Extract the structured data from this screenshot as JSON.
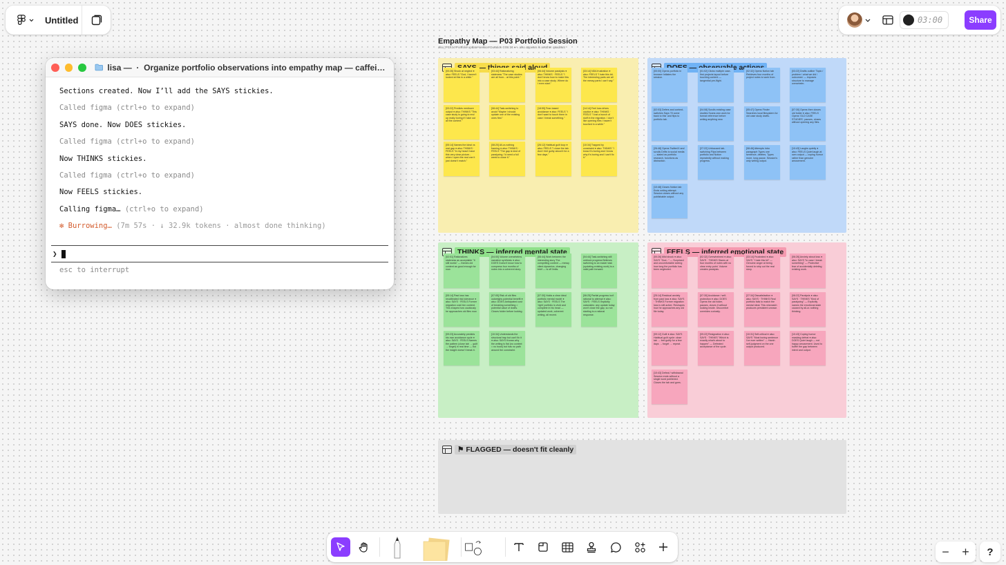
{
  "file": {
    "title": "Untitled"
  },
  "topbar": {
    "timer": "03:00",
    "share_label": "Share"
  },
  "terminal": {
    "folder": "lisa —",
    "title": "Organize portfolio observations into empathy map — caffeinate...",
    "lines": [
      {
        "text": "Sections created. Now I’ll add the SAYS stickies.",
        "style": "bold"
      },
      {
        "text": "Called figma (ctrl+o to expand)",
        "style": "dim"
      },
      {
        "text": "SAYS done. Now DOES stickies.",
        "style": "bold"
      },
      {
        "text": "Called figma (ctrl+o to expand)",
        "style": "dim"
      },
      {
        "text": "Now THINKS stickies.",
        "style": "bold"
      },
      {
        "text": "Called figma (ctrl+o to expand)",
        "style": "dim"
      },
      {
        "text": "Now FEELS stickies.",
        "style": "bold"
      },
      {
        "text": "Calling figma…",
        "style": "bold",
        "suffix": "(ctrl+o to expand)"
      }
    ],
    "status": {
      "star": "✻",
      "word": "Burrowing…",
      "meta": "(7m 57s · ↓ 32.9k tokens · almost done thinking)"
    },
    "prompt_symbol": "❯",
    "hint": "esc to interrupt"
  },
  "board": {
    "title": "Empathy Map — P03 Portfolio Session",
    "subtitle": "also_P03.txt     Portfolio update session     Duration 0:26:14     ● = also appears in another quadrant",
    "sections": [
      {
        "id": "says",
        "label": "SAYS — things said aloud",
        "color": "#f9eeb0",
        "tag_color": "#f7dc4a",
        "sticky_color": "#fde74c",
        "stickies": [
          "[00:26] Shock at neglect ● also: FEELS \"God, I haven't looked at this in a while.\"",
          "[03:44] Rationalizing staleness \"The case studies are all from... at this point.\"",
          "[06:44] Volume paralysis ● also: THINKS · FEELS \"I don't know how to make this into a case study. Where do I even start.\"",
          "[33:14] NDA frustration ● also: FEELS \"I hate this bit. The interesting parts are all the messy parts I can't say.\"",
          "[03:22] Predicts mediocre output ● also: THINKS \"This case study is going to end up really boring if I take out all the context.\"",
          "[08:44] Task-switching to avoid \"Maybe I should update one of the existing ones first.\"",
          "[18:55] Fear-based avoidance ● also: FEELS \"I don't want to touch them in case I break something.\"",
          "[14:14] Feel loss drives caution ● also: THINKS · FEELS \"I lost a bunch of stuff in the migration. I don't like opening files I haven't touched in a while.\"",
          "[05:14] Names the ideal vs real gap ● also: THINKS · FEELS \"In my head I have this very clear picture... when I open the real one it just doesn't match.\"",
          "[08:20] All-or-nothing framing ● also: THINKS · FEELS \"The gap is kind of paralyzing. I'd need a full week to close it.\"",
          "[26:12] Habitual guilt loop ● also: FEELS \"I close the tab. And I feel guilty about it for a few days.\"",
          "[10:34] Trapped by constraint ● also: THINKS \"I know it's boring and I know why it's boring and I can't fix it.\""
        ]
      },
      {
        "id": "does",
        "label": "DOES — observable actions",
        "color": "#c0d9f9",
        "tag_color": "#6fb2f5",
        "sticky_color": "#8ec2f6",
        "stickies": [
          "[00:00] Opens portfolio in browser Initiates the session.",
          "[01:02] Clicks multiple case-first projects layout before touching content — tangential pre-flight.",
          "[02:32] Opens Notion tab Retrieves four months of project notes to work from.",
          "[03:22] Drafts outline 'Topic / problem / what we did / outcomes' — imposes structure to manage overwhelm.",
          "[02:03] Defers and context-switches Says 'I'll come back to this' and flips to portfolio tab.",
          "[04:08] Scrolls existing case studies Scans own work for format reference before writing anything new.",
          "[05:47] Opens Finder Searches local filesystem for old case study drafts.",
          "[07:30] Opens then closes old folder ● also: FEELS Opens 'OLD CASE STUDIES', pauses, closes without opening any files.",
          "[26:48] Opens Twitter/X and scrolls Drifts to social media — stated as portfolio research, functions as distraction.",
          "[27:22] Unfocused tab-switching Flips between portfolio and Notion repeatedly without making progress.",
          "[08:46] Attempts intro paragraph Types one sentence, deletes. Types more, long pause. Session's only writing output.",
          "[10:43] Laughs quietly ● also: FEELS Quiet laugh at own output — coping humor rather than genuine amusement.",
          "[10:48] Closes Notion tab Ends writing attempt. Session closes without any publishable output."
        ]
      },
      {
        "id": "thinks",
        "label": "THINKS — inferred mental state",
        "color": "#c8efc5",
        "tag_color": "#8fe08a",
        "sticky_color": "#9be39a",
        "stickies": [
          "[02:01] Rationalizes staleness as acceptable \"It still works\" — frames old content as good enough for now.",
          "[04:00] Volume overwhelms narrative synthesis ● also: DOES Doesn't know how to compress four months of notes into a coherent story.",
          "[06:44] Work between the interesting story The compelling content — messy client dynamics, changing brief — is off limits.",
          "[04:44] Task-switching still unblock progress Believes switching to an easier task (updating existing work) is a valid path forward.",
          "[05:14] Past loss has recalibrated risk tolerance ● also: SAYS · FEELS Former migration cost him content. This shapes how cautiously he approaches old files now.",
          "[07:05] Risk of old files outweighs potential benefit ● also: DOES Anticipated cost of breaking something > potential value of drafts. Closes folder before looking.",
          "[07:30] Holds a clear ideal portfolio mental model ● also: SAYS · FEELS The 'right' portfolio is vivid and complete in his head — updated work, coherent writing, all recent.",
          "[06:25] Partial progress isn't rational to attempt ● also: SAYS · FEELS Implicitly calculates: any update today won't close the gap, so not starting is a rational response.",
          "[09:23] Accurately predicts his own avoidance cycle ● also: SAYS · FEELS Names the pattern (close tab → guilt → forget) in real time — but the insight doesn't break it.",
          "[10:34] Understands the structural trap but can't fix it ● also: SAYS Knows why the writing is flat (no context = no hook) but has no path around the constraint."
        ]
      },
      {
        "id": "feels",
        "label": "FEELS — inferred emotional state",
        "color": "#f9cdd7",
        "tag_color": "#f59ab0",
        "sticky_color": "#f7a6bd",
        "stickies": [
          "[00:26] Mild shock ● also: SAYS \"God...\" — Surprised and uncomfortable seeing how long the portfolio has been neglected.",
          "[02:32] Overwhelmed ● also: SAYS · THINKS Stares at four months of notes with no clear entry point. Volume creates paralysis.",
          "[33:14] Frustrated ● also: SAYS \"I hate this bit\" — Genuine anger at being forced to strip out the real story.",
          "[06:26] Anxiety about loss ● also: SAYS \"In case I break something\" — Protective fear of accidentally deleting existing work.",
          "[25:14] Residual anxiety from past loss ● also: SAYS · THINKS Former migration loss is still active. Reshapes how he approaches any old file today.",
          "[07:30] Avoidance / self-protection ● also: DOES Opens the old folder, pauses, closes it without looking inside. Discomfort overrides curiosity.",
          "[27:34] Dissatisfaction ● also: SAYS · THINKS Real portfolio fails to match the mental ideal. This mismatch produces persistent unease.",
          "[08:22] Paralysis ● also: SAYS · THINKS \"Kind of paralyzing\" — Explicitly names the emotional state caused by all-or-nothing thinking.",
          "[09:12] Guilt ● also: SAYS Habitual guilt cycle: close tab → feel guilty for a few days → forget → repeat.",
          "[09:22] Resignation ● also: SAYS · THINKS \"Which is exactly what's about to happen\" — Defeated acceptance of the cycle.",
          "[10:31] Self-critical ● also: SAYS \"Most boring sentence I've ever written\" — Harsh self-judgment on the one output produced.",
          "[10:43] Coping humor masking defeat ● also: DOES Quiet laugh — not happy amusement. Used to buffer the gap between intent and output.",
          "[10:43] Defeat / withdrawal Session ends without a single word published. Closes the tab and goes."
        ]
      },
      {
        "id": "flagged",
        "label": "⚑ FLAGGED — doesn't fit cleanly",
        "color": "#e2e2e2",
        "tag_color": "#d0d0d0",
        "sticky_color": "#ffffff",
        "stickies": []
      }
    ]
  },
  "tools": [
    {
      "name": "move-tool",
      "icon": "cursor-icon",
      "active": true
    },
    {
      "name": "hand-tool",
      "icon": "hand-icon"
    },
    {
      "name": "pen-tool",
      "icon": "marker-icon"
    },
    {
      "name": "sticky-tool",
      "icon": "sticky-note-icon"
    },
    {
      "name": "shape-tool",
      "icon": "shapes-icon"
    },
    {
      "name": "text-tool",
      "icon": "text-icon"
    },
    {
      "name": "section-tool",
      "icon": "section-icon"
    },
    {
      "name": "table-tool",
      "icon": "table-icon"
    },
    {
      "name": "stamp-tool",
      "icon": "stamp-icon"
    },
    {
      "name": "comment-tool",
      "icon": "comment-icon"
    },
    {
      "name": "widgets-tool",
      "icon": "widgets-icon"
    },
    {
      "name": "more-tool",
      "icon": "plus-icon"
    }
  ],
  "zoom": {
    "minus": "−",
    "plus": "+"
  },
  "help": {
    "label": "?"
  },
  "colors": {
    "accent": "#8b3dff",
    "orange": "#d35a2b",
    "traffic_red": "#ff5f57",
    "traffic_yellow": "#febc2e",
    "traffic_green": "#28c840"
  }
}
